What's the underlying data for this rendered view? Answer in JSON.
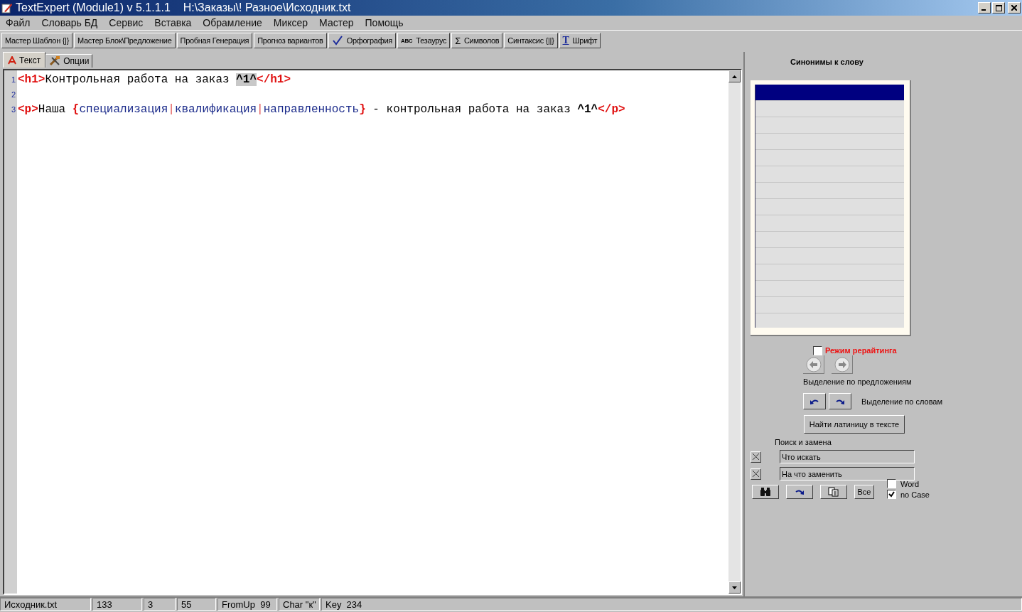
{
  "window": {
    "title": "TextExpert (Module1) v 5.1.1.1    H:\\Заказы\\! Разное\\Исходник.txt"
  },
  "menu": [
    "Файл",
    "Словарь БД",
    "Сервис",
    "Вставка",
    "Обрамление",
    "Миксер",
    "Мастер",
    "Помощь"
  ],
  "toolbar": [
    {
      "label": "Мастер Шаблон {|}",
      "kind": "plain"
    },
    {
      "label": "Мастер Блок\\Предложение",
      "kind": "plain"
    },
    {
      "label": "Пробная Генерация",
      "kind": "plain"
    },
    {
      "label": "Прогноз вариантов",
      "kind": "plain"
    },
    {
      "label": "Орфография",
      "kind": "spell"
    },
    {
      "label": "Тезаурус",
      "kind": "thesaurus",
      "icon_text": "ABC"
    },
    {
      "label": "Символов",
      "kind": "sigma",
      "icon_text": "Σ"
    },
    {
      "label": "Синтаксис {||}",
      "kind": "plain"
    },
    {
      "label": "Шрифт",
      "kind": "font",
      "icon_text": "T"
    }
  ],
  "tabs": [
    {
      "label": "Текст",
      "selected": true,
      "kind": "text"
    },
    {
      "label": "Опции",
      "selected": false,
      "kind": "tools"
    }
  ],
  "editor": {
    "lines": [
      {
        "number": "1",
        "segments": [
          {
            "kind": "tag",
            "text": "<h1>"
          },
          {
            "kind": "text",
            "text": "Контрольная работа на заказ "
          },
          {
            "kind": "marker",
            "text": "^1^",
            "selected": true
          },
          {
            "kind": "tag",
            "text": "</h1>"
          }
        ]
      },
      {
        "number": "2"
      },
      {
        "number": "3",
        "segments": [
          {
            "kind": "tag",
            "text": "<p>"
          },
          {
            "kind": "text",
            "text": "Наша "
          },
          {
            "kind": "brace",
            "text": "{"
          },
          {
            "kind": "option",
            "text": "специализация"
          },
          {
            "kind": "pipe",
            "text": "|"
          },
          {
            "kind": "option",
            "text": "квалификация"
          },
          {
            "kind": "pipe",
            "text": "|"
          },
          {
            "kind": "option",
            "text": "направленность"
          },
          {
            "kind": "brace",
            "text": "}"
          },
          {
            "kind": "text",
            "text": " - контрольная работа на заказ "
          },
          {
            "kind": "marker",
            "text": "^1^",
            "selected": false
          },
          {
            "kind": "tag",
            "text": "</p>"
          }
        ]
      }
    ]
  },
  "synonyms": {
    "title": "Синонимы к слову",
    "rows": [
      {
        "selected": true
      },
      {
        "selected": false
      },
      {
        "selected": false
      },
      {
        "selected": false
      },
      {
        "selected": false
      },
      {
        "selected": false
      },
      {
        "selected": false
      },
      {
        "selected": false
      },
      {
        "selected": false
      },
      {
        "selected": false
      },
      {
        "selected": false
      },
      {
        "selected": false
      },
      {
        "selected": false
      },
      {
        "selected": false
      },
      {
        "selected": false
      }
    ]
  },
  "rewrite_mode": {
    "label": "Режим рерайтинга",
    "checked": false
  },
  "sentence_selection_label": "Выделение по предложениям",
  "word_selection_label": "Выделение по словам",
  "find_latin_button": "Найти латиницу в тексте",
  "search": {
    "title": "Поиск и замена",
    "find_placeholder": "Что искать",
    "replace_placeholder": "На что заменить",
    "all_button": "Все",
    "options": [
      {
        "label": "Word",
        "checked": false
      },
      {
        "label": "no Case",
        "checked": true
      }
    ]
  },
  "status_bar": [
    "Исходник.txt",
    "133",
    "3",
    "55",
    "FromUp  99",
    "Char \"к\"",
    "Key  234"
  ]
}
